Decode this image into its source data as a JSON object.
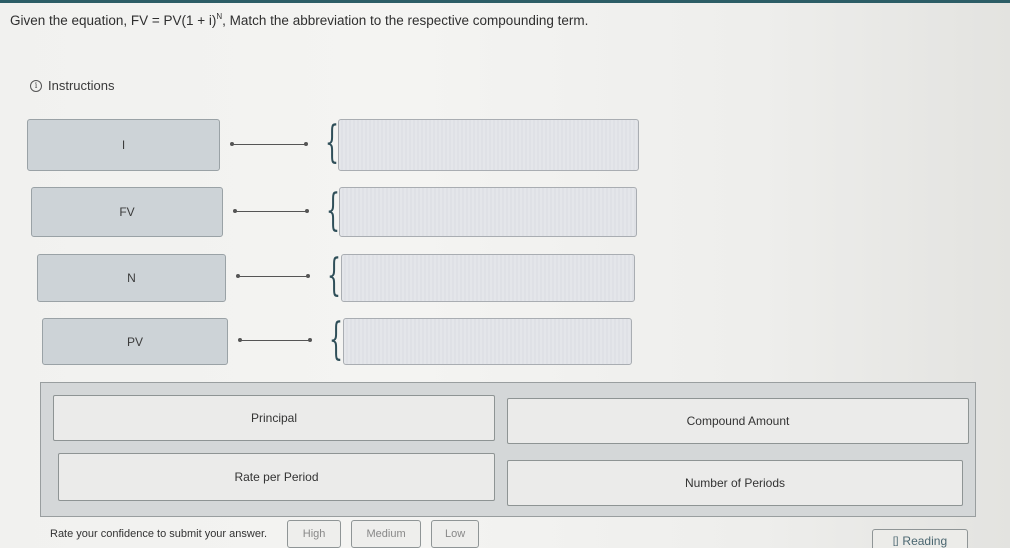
{
  "question": {
    "prefix": "Given the equation, ",
    "equation_base": "FV = PV(1 + i)",
    "equation_exponent": "N",
    "suffix": ", Match the abbreviation to the respective compounding term."
  },
  "instructions": {
    "icon": "info-icon",
    "icon_glyph": "i",
    "label": "Instructions"
  },
  "matching": {
    "rows": [
      {
        "term": "I",
        "answer": ""
      },
      {
        "term": "FV",
        "answer": ""
      },
      {
        "term": "N",
        "answer": ""
      },
      {
        "term": "PV",
        "answer": ""
      }
    ]
  },
  "answer_bank": {
    "options": [
      "Principal",
      "Compound Amount",
      "Rate per Period",
      "Number of Periods"
    ]
  },
  "confidence": {
    "label": "Rate your confidence to submit your answer.",
    "buttons": [
      "High",
      "Medium",
      "Low"
    ]
  },
  "reading": {
    "icon": "book-icon",
    "icon_glyph": "[]",
    "label": "Reading"
  },
  "colors": {
    "accent_bar": "#2c5d66",
    "term_fill": "#cdd3d7",
    "dropzone_fill": "#e4e6ea",
    "bank_fill": "#d4d7d8"
  }
}
